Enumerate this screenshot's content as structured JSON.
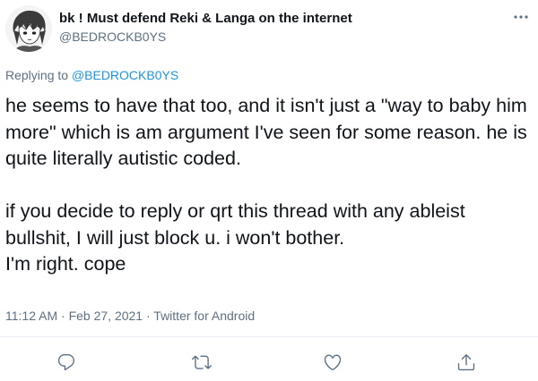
{
  "author": {
    "display_name": "bk ! Must defend Reki & Langa on the internet",
    "handle": "@BEDROCKB0YS",
    "avatar_icon": "anime-avatar"
  },
  "reply_context": {
    "prefix": "Replying to ",
    "handle": "@BEDROCKB0YS"
  },
  "tweet": {
    "text": "he seems to have that too, and it isn't just a \"way to baby him more\" which is am argument I've seen for some reason. he is quite literally autistic coded.\n\nif you decide to reply or qrt this thread with any ableist bullshit, I will just block u. i won't bother.\nI'm right. cope",
    "time": "11:12 AM",
    "sep1": " · ",
    "date": "Feb 27, 2021",
    "sep2": " · ",
    "source": "Twitter for Android"
  },
  "actions": [
    {
      "name": "reply",
      "icon": "reply-icon"
    },
    {
      "name": "retweet",
      "icon": "retweet-icon"
    },
    {
      "name": "like",
      "icon": "like-icon"
    },
    {
      "name": "share",
      "icon": "share-icon"
    }
  ],
  "colors": {
    "text": "#0f1419",
    "secondary": "#5b7083",
    "link": "#1b95e0",
    "icon": "#5b7083"
  }
}
